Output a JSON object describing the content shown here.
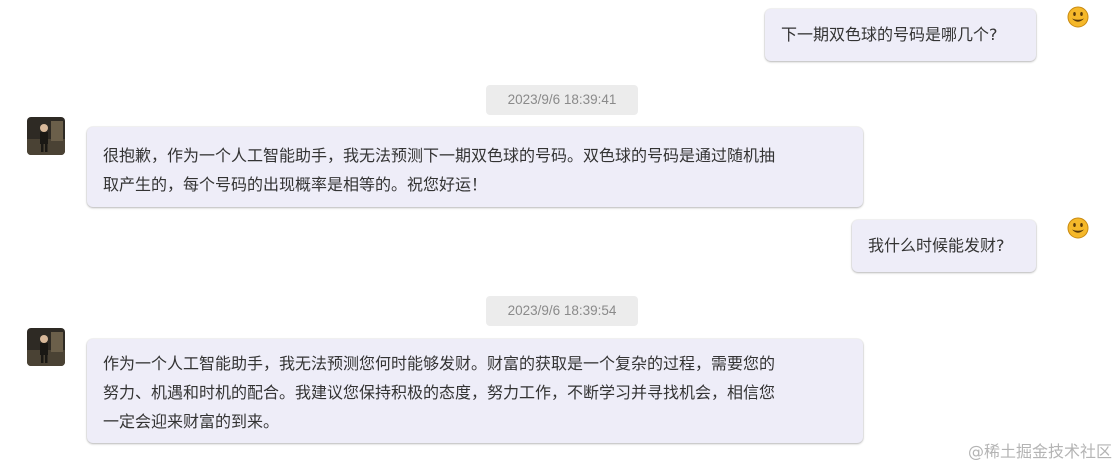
{
  "messages": [
    {
      "role": "user",
      "text": "下一期双色球的号码是哪几个?",
      "icon": "smiley-emoji-icon"
    },
    {
      "role": "timestamp",
      "text": "2023/9/6 18:39:41"
    },
    {
      "role": "assistant",
      "lines": [
        "很抱歉，作为一个人工智能助手，我无法预测下一期双色球的号码。双色球的号码是通过随机抽",
        "取产生的，每个号码的出现概率是相等的。祝您好运！"
      ],
      "icon": "assistant-avatar"
    },
    {
      "role": "user",
      "text": "我什么时候能发财?",
      "icon": "smiley-emoji-icon"
    },
    {
      "role": "timestamp",
      "text": "2023/9/6 18:39:54"
    },
    {
      "role": "assistant",
      "lines": [
        "作为一个人工智能助手，我无法预测您何时能够发财。财富的获取是一个复杂的过程，需要您的",
        "努力、机遇和时机的配合。我建议您保持积极的态度，努力工作，不断学习并寻找机会，相信您",
        "一定会迎来财富的到来。"
      ],
      "icon": "assistant-avatar"
    }
  ],
  "watermark": "@稀土掘金技术社区",
  "colors": {
    "bubble_bg": "#eeedf8",
    "timestamp_bg": "#ececec",
    "text": "#333333",
    "emoji_face": "#f5b82a"
  }
}
